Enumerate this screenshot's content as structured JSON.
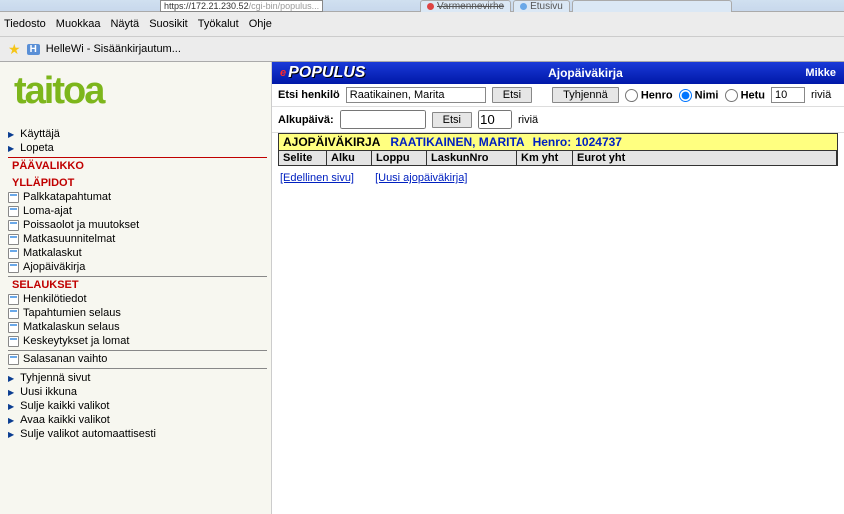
{
  "browser": {
    "url_fragment": "172.21.230.52",
    "url_rest": "/cgi-bin/populus...",
    "tab1": "Varmennevirhe",
    "tab2": "Etusivu"
  },
  "menu": {
    "items": [
      "Tiedosto",
      "Muokkaa",
      "Näytä",
      "Suosikit",
      "Työkalut",
      "Ohje"
    ]
  },
  "favbar": {
    "h_label": "H",
    "fav_title": "HelleWi - Sisäänkirjautum..."
  },
  "sidebar": {
    "logo": "taitoa",
    "top": [
      {
        "label": "Käyttäjä"
      },
      {
        "label": "Lopeta"
      }
    ],
    "section1": "PÄÄVALIKKO",
    "section2": "YLLÄPIDOT",
    "yllapidot": [
      {
        "label": "Palkkatapahtumat"
      },
      {
        "label": "Loma-ajat"
      },
      {
        "label": "Poissaolot ja muutokset"
      },
      {
        "label": "Matkasuunnitelmat"
      },
      {
        "label": "Matkalaskut"
      },
      {
        "label": "Ajopäiväkirja"
      }
    ],
    "section3": "SELAUKSET",
    "selaukset": [
      {
        "label": "Henkilötiedot"
      },
      {
        "label": "Tapahtumien selaus"
      },
      {
        "label": "Matkalaskun selaus"
      },
      {
        "label": "Keskeytykset ja lomat"
      }
    ],
    "salasana": "Salasanan vaihto",
    "bottom": [
      {
        "label": "Tyhjennä sivut"
      },
      {
        "label": "Uusi ikkuna"
      },
      {
        "label": "Sulje kaikki valikot"
      },
      {
        "label": "Avaa kaikki valikot"
      },
      {
        "label": "Sulje valikot automaattisesti"
      }
    ]
  },
  "header": {
    "brand_e": "e",
    "brand_rest": "POPULUS",
    "center": "Ajopäiväkirja",
    "right": "Mikke"
  },
  "search": {
    "label": "Etsi henkilö",
    "value": "Raatikainen, Marita",
    "btn_search": "Etsi",
    "btn_clear": "Tyhjennä",
    "radio_henro": "Henro",
    "radio_nimi": "Nimi",
    "radio_hetu": "Hetu",
    "count": "10",
    "rivia": "riviä"
  },
  "daterow": {
    "label": "Alkupäivä:",
    "value": "",
    "btn_search": "Etsi",
    "count": "10",
    "rivia": "riviä"
  },
  "record": {
    "title": "AJOPÄIVÄKIRJA",
    "name": "RAATIKAINEN, MARITA",
    "henro_label": "Henro:",
    "henro_value": "1024737",
    "headers": {
      "selite": "Selite",
      "alku": "Alku",
      "loppu": "Loppu",
      "laskun": "LaskunNro",
      "km": "Km yht",
      "eurot": "Eurot yht"
    }
  },
  "paging": {
    "prev": "[Edellinen sivu]",
    "new": "[Uusi ajopäiväkirja]"
  }
}
